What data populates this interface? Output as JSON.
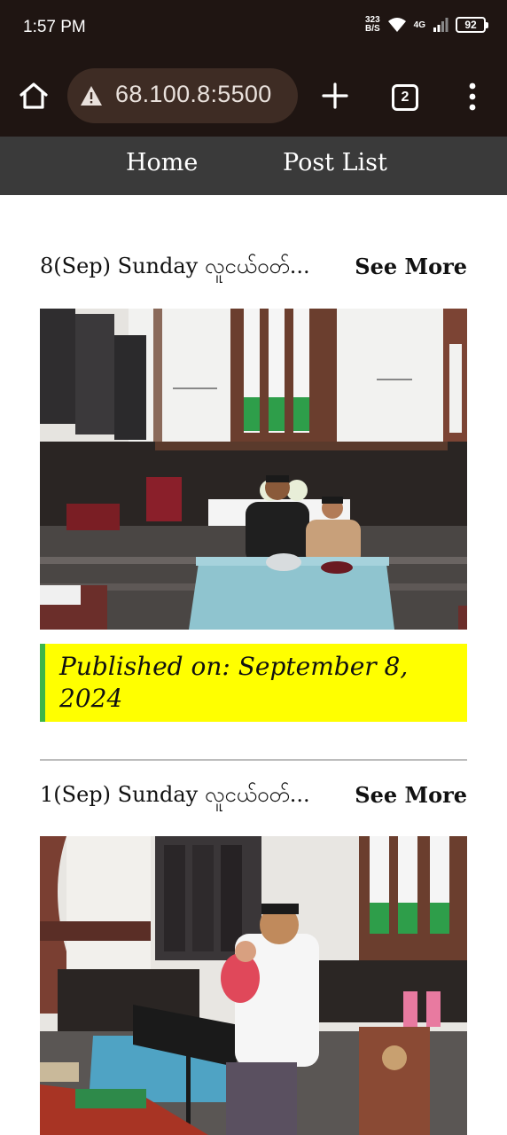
{
  "status_bar": {
    "time": "1:57 PM",
    "net_speed_value": "323",
    "net_speed_unit": "B/S",
    "network_type": "4G",
    "battery": "92"
  },
  "browser": {
    "url": "68.100.8:5500",
    "tab_count": "2"
  },
  "nav": {
    "home": "Home",
    "post_list": "Post List"
  },
  "posts": [
    {
      "title": "8(Sep) Sunday လူငယ်ဝတ်...",
      "see_more": "See More",
      "published": "Published on: September 8, 2024"
    },
    {
      "title": "1(Sep) Sunday လူငယ်ဝတ်...",
      "see_more": "See More"
    }
  ],
  "colors": {
    "status_bg": "#1f1512",
    "nav_bg": "#3a3a3a",
    "published_bg": "#ffff00",
    "published_border": "#3db54a"
  }
}
